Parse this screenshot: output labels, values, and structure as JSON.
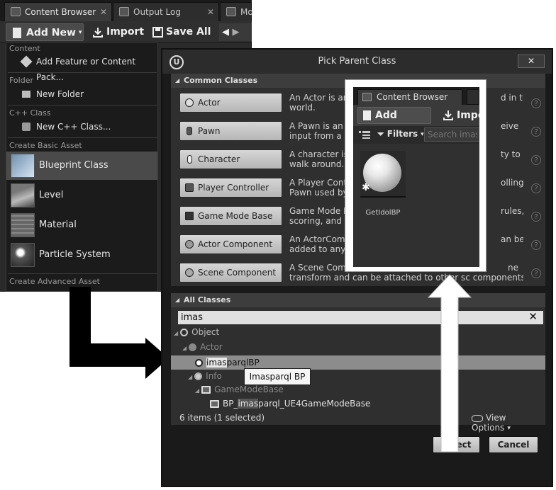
{
  "content_browser": {
    "tabs": [
      {
        "label": "Content Browser",
        "active": true
      },
      {
        "label": "Output Log",
        "active": false
      },
      {
        "label": "Mo",
        "active": false
      }
    ],
    "tab_close_glyph": "✕",
    "toolbar": {
      "add_new": "Add New",
      "import": "Import",
      "save_all": "Save All",
      "caret": "▾",
      "back": "◀",
      "forward": "▶"
    },
    "menu": {
      "sections": {
        "content": "Content",
        "folder": "Folder",
        "cpp": "C++ Class",
        "basic": "Create Basic Asset",
        "advanced": "Create Advanced Asset"
      },
      "add_feature": "Add Feature or Content Pack...",
      "new_folder": "New Folder",
      "new_cpp": "New C++ Class...",
      "basic_assets": [
        "Blueprint Class",
        "Level",
        "Material",
        "Particle System"
      ],
      "selected": "Blueprint Class"
    }
  },
  "dialog": {
    "title": "Pick Parent Class",
    "logo": "U",
    "close": "✕",
    "common_header": "Common Classes",
    "header_triangle": "◢",
    "help_glyph": "?",
    "classes": [
      {
        "label": "Actor",
        "desc1": "An Actor is an o",
        "desc_tail1": "d in the",
        "desc2": "world."
      },
      {
        "label": "Pawn",
        "desc1": "A Pawn is an a",
        "desc_tail1": "eive",
        "desc2": "input from a co"
      },
      {
        "label": "Character",
        "desc1": "A character is a",
        "desc_tail1": "ty to",
        "desc2": "walk around."
      },
      {
        "label": "Player Controller",
        "desc1": "A Player Contro",
        "desc_tail1": "olling a",
        "desc2": "Pawn used by t"
      },
      {
        "label": "Game Mode Base",
        "desc1": "Game Mode Ba",
        "desc_tail1": "rules,",
        "desc2": "scoring, and ot"
      },
      {
        "label": "Actor Component",
        "desc1": "An ActorCompo",
        "desc_tail1": "an be",
        "desc2": "added to any a"
      },
      {
        "label": "Scene Component",
        "desc1": "A Scene Compo",
        "desc_tail1": "ne",
        "desc2": "transform and can be attached to other sc",
        "desc2_tail": "components."
      }
    ],
    "all_header": "All Classes",
    "search_value": "imas",
    "search_clear": "✕",
    "tree": {
      "object": "Object",
      "actor": "Actor",
      "imasparql_prefix": "imas",
      "imasparql_rest": "parqlBP",
      "info": "Info",
      "gamemodebase": "GameModeBase",
      "bp_gm_prefix": "BP_",
      "bp_gm_hl": "imas",
      "bp_gm_rest": "parql_UE4GameModeBase"
    },
    "tooltip": "Imasparql BP",
    "item_count": "6 items (1 selected)",
    "view_options": "View Options",
    "select": "Select",
    "cancel": "Cancel"
  },
  "inset": {
    "tab_label": "Content Browser",
    "add_new": "Add New",
    "import": "Impor",
    "filters": "Filters",
    "search_placeholder": "Search imasbo",
    "asset_name": "GetIdolBP"
  }
}
